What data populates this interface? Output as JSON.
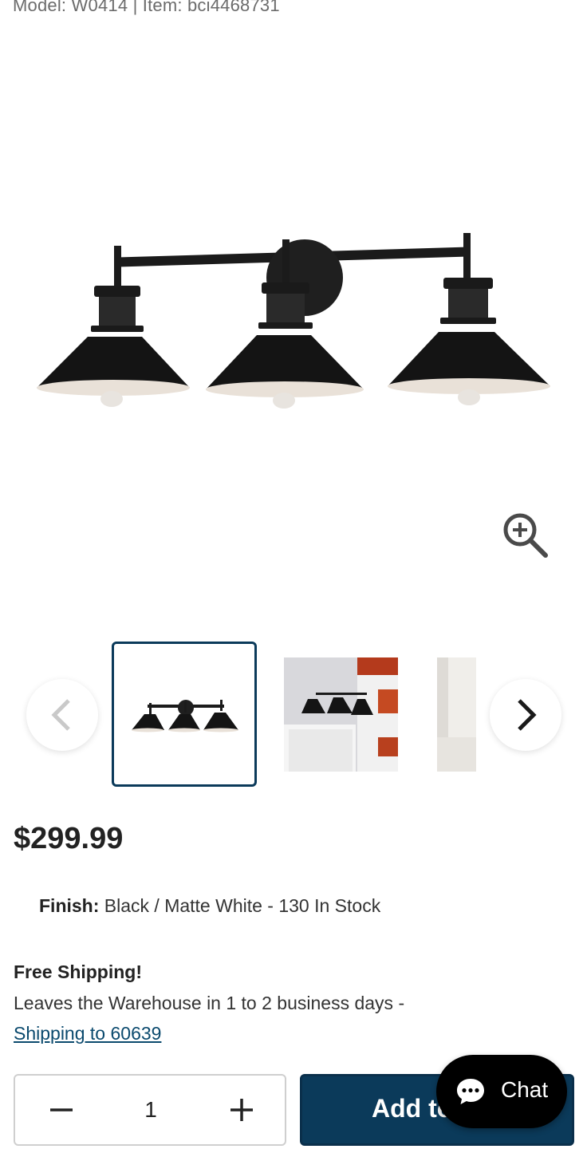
{
  "product": {
    "model_line": "Model: W0414 | Item: bci4468731",
    "price": "$299.99",
    "finish_label": "Finish:",
    "finish_value": " Black / Matte White - 130 In Stock"
  },
  "gallery": {
    "images": [
      "three-light-vanity-fixture",
      "vanity-in-bathroom",
      "bathroom-partial"
    ],
    "selected_index": 0
  },
  "shipping": {
    "title": "Free Shipping!",
    "description": "Leaves the Warehouse in 1 to 2 business days -",
    "link": "Shipping to 60639"
  },
  "purchase": {
    "quantity": "1",
    "add_label": "Add to Cart"
  },
  "chat": {
    "label": "Chat"
  },
  "colors": {
    "brand": "#0b3a5a",
    "link": "#0b4a6e",
    "chat": "#000000"
  }
}
